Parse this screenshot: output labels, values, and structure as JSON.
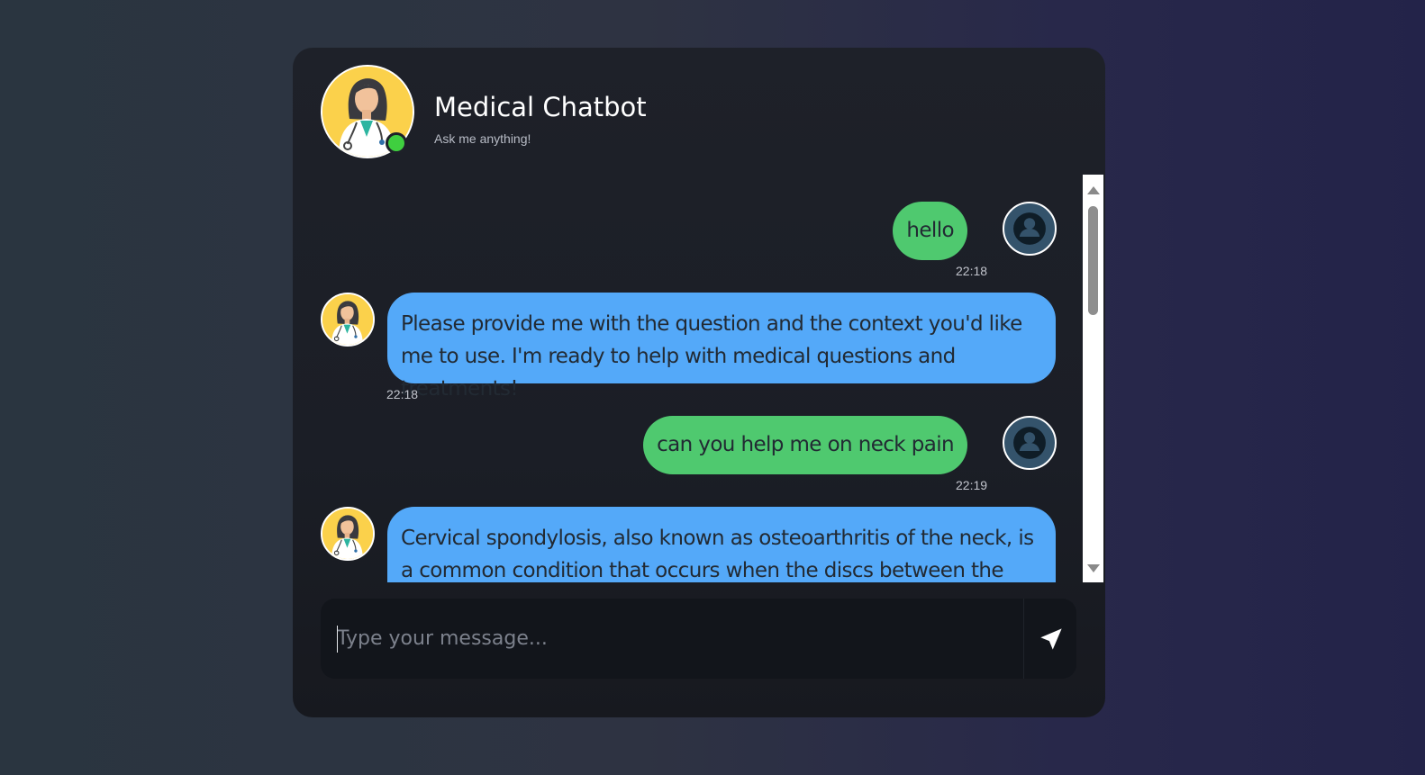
{
  "header": {
    "title": "Medical Chatbot",
    "subtitle": "Ask me anything!",
    "status": "online"
  },
  "messages": [
    {
      "sender": "user",
      "text": "hello",
      "time": "22:18"
    },
    {
      "sender": "bot",
      "text": "Please provide me with the question and the context you'd like me to use. I'm ready to help with medical questions and treatments!",
      "time": "22:18"
    },
    {
      "sender": "user",
      "text": "can you help me on neck pain",
      "time": "22:19"
    },
    {
      "sender": "bot",
      "text": "Cervical spondylosis, also known as osteoarthritis of the neck, is a common condition that occurs when the discs between the"
    }
  ],
  "composer": {
    "placeholder": "Type your message...",
    "value": ""
  },
  "icons": {
    "send": "send-icon",
    "user_avatar": "user-icon",
    "bot_avatar": "doctor-avatar"
  },
  "colors": {
    "user_bubble": "#4fc96f",
    "bot_bubble": "#54a9f9",
    "online": "#3fcf3f",
    "avatar_bg": "#fbd14b"
  }
}
